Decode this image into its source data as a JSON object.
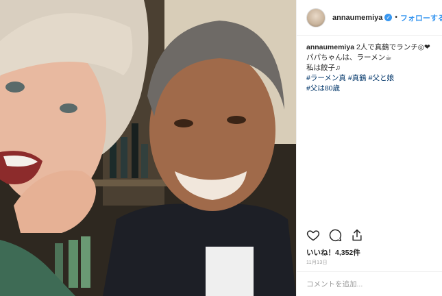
{
  "header": {
    "username": "annaumemiya",
    "separator": "•",
    "follow_label": "フォローする",
    "verified_mark": "✓"
  },
  "caption": {
    "username": "annaumemiya",
    "line1": " 2人で真鶴でランチ◎❤",
    "line2": "パパちゃんは、ラーメン☕",
    "line3": "私は餃子♫",
    "hashtags_line1": [
      "#ラーメン真",
      "#真鶴",
      "#父と娘"
    ],
    "hashtags_line2": [
      "#父は80歳"
    ]
  },
  "actions": {
    "like_icon": "heart-icon",
    "comment_icon": "comment-icon",
    "share_icon": "share-icon"
  },
  "likes": "いいね！4,352件",
  "date": "11月13日",
  "comment": {
    "placeholder": "コメントを追加..."
  }
}
